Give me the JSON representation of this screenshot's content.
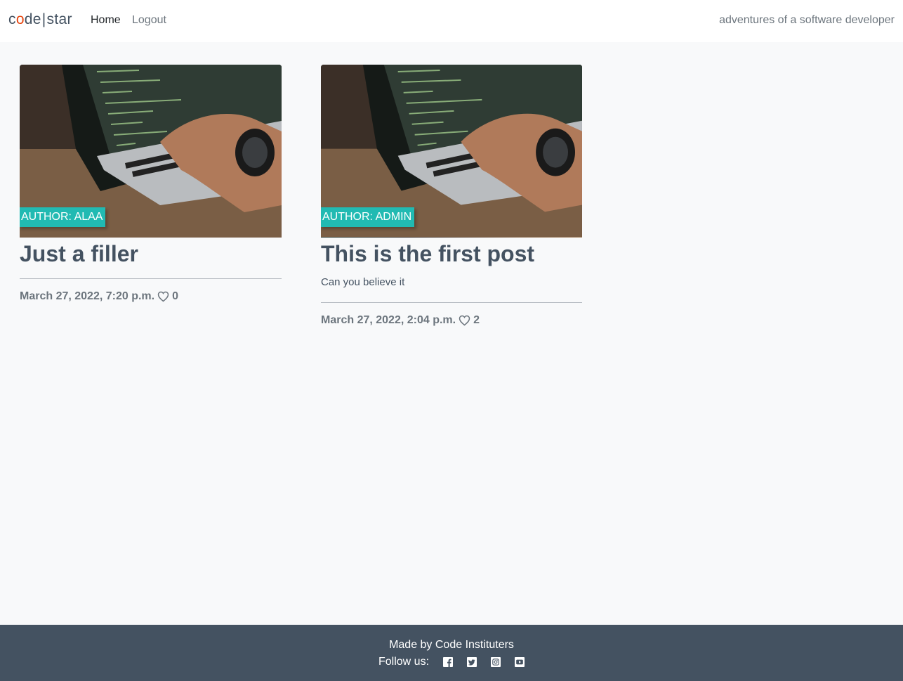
{
  "nav": {
    "brand_part1_a": "c",
    "brand_part1_b": "o",
    "brand_part1_c": "de",
    "brand_separator": "|",
    "brand_part2": "star",
    "links": [
      {
        "label": "Home",
        "active": true
      },
      {
        "label": "Logout",
        "active": false
      }
    ],
    "tagline": "adventures of a software developer"
  },
  "posts": [
    {
      "author": "AUTHOR: ALAA",
      "title": "Just a filler",
      "excerpt": "",
      "date": "March 27, 2022, 7:20 p.m.",
      "likes": "0"
    },
    {
      "author": "AUTHOR: ADMIN",
      "title": "This is the first post",
      "excerpt": "Can you believe it",
      "date": "March 27, 2022, 2:04 p.m.",
      "likes": "2"
    }
  ],
  "footer": {
    "made_by": "Made by Code Instituters",
    "follow_label": "Follow us:",
    "social_icons": [
      "facebook-icon",
      "twitter-icon",
      "instagram-icon",
      "youtube-icon"
    ]
  },
  "colors": {
    "accent": "#21bab2",
    "brand_dot": "#e84610",
    "footer_bg": "#445261",
    "page_bg": "#f8f9fa"
  }
}
